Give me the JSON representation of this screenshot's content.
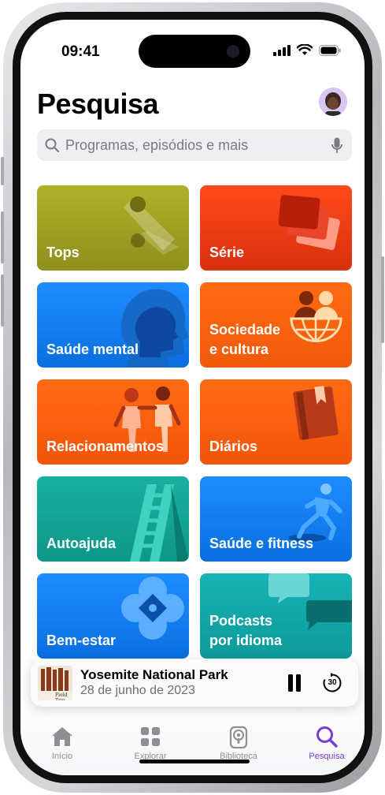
{
  "status": {
    "time": "09:41"
  },
  "header": {
    "title": "Pesquisa"
  },
  "search": {
    "placeholder": "Programas, episódios e mais",
    "icon": "magnifier-icon",
    "mic_icon": "microphone-icon"
  },
  "categories": [
    {
      "label": "Tops",
      "color_top": "#b0b12a",
      "color_bottom": "#8f8f1c"
    },
    {
      "label": "Série",
      "color_top": "#ff4a1a",
      "color_bottom": "#d9300e"
    },
    {
      "label": "Saúde mental",
      "color_top": "#1e8cff",
      "color_bottom": "#0a6fe0"
    },
    {
      "label": "Sociedade\ne cultura",
      "color_top": "#ff6a14",
      "color_bottom": "#f05a0a"
    },
    {
      "label": "Relacionamentos",
      "color_top": "#ff6a14",
      "color_bottom": "#f2550a"
    },
    {
      "label": "Diários",
      "color_top": "#ff6a14",
      "color_bottom": "#f2550a"
    },
    {
      "label": "Autoajuda",
      "color_top": "#18b0a0",
      "color_bottom": "#0e9788"
    },
    {
      "label": "Saúde e fitness",
      "color_top": "#1e8cff",
      "color_bottom": "#0a6fe0"
    },
    {
      "label": "Bem-estar",
      "color_top": "#1e8cff",
      "color_bottom": "#0a6fe0"
    },
    {
      "label": "Podcasts\npor idioma",
      "color_top": "#17b3b3",
      "color_bottom": "#0e9a9a"
    }
  ],
  "mini_player": {
    "title": "Yosemite National Park",
    "date": "28 de junho de 2023",
    "art_text": "Field Trip",
    "pause_icon": "pause-icon",
    "skip_icon": "skip-forward-30-icon",
    "skip_label": "30"
  },
  "tabs": [
    {
      "label": "Início",
      "icon": "house-icon",
      "active": false
    },
    {
      "label": "Explorar",
      "icon": "grid-icon",
      "active": false
    },
    {
      "label": "Biblioteca",
      "icon": "podcast-icon",
      "active": false
    },
    {
      "label": "Pesquisa",
      "icon": "magnifier-icon",
      "active": true
    }
  ],
  "accent_color": "#7a3ad6"
}
